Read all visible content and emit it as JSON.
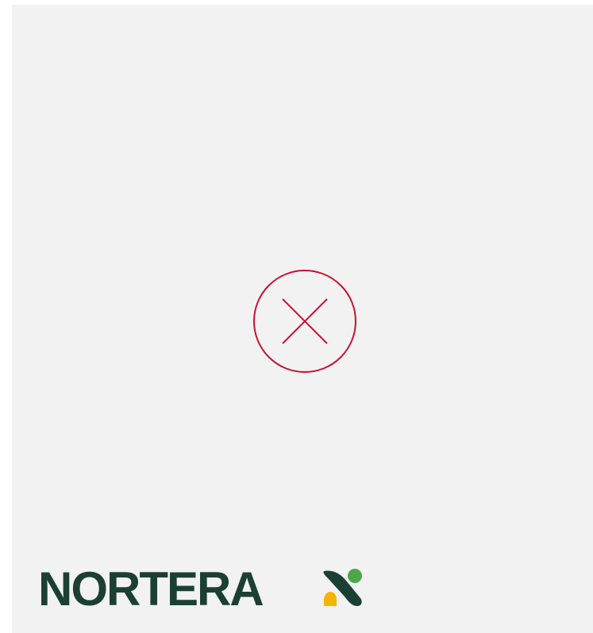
{
  "brand": {
    "wordmark": "NORTERA",
    "logo_icon": "nortera-leaf-logo-icon",
    "colors": {
      "wordmark": "#1c3f34",
      "leaf_dark": "#1c3f34",
      "dot_green": "#4ea64b",
      "drop_yellow": "#f5b400"
    }
  },
  "dialog": {
    "close_icon": "close-circle-icon",
    "accent_color": "#c8102e"
  },
  "background": "#f2f2f2"
}
